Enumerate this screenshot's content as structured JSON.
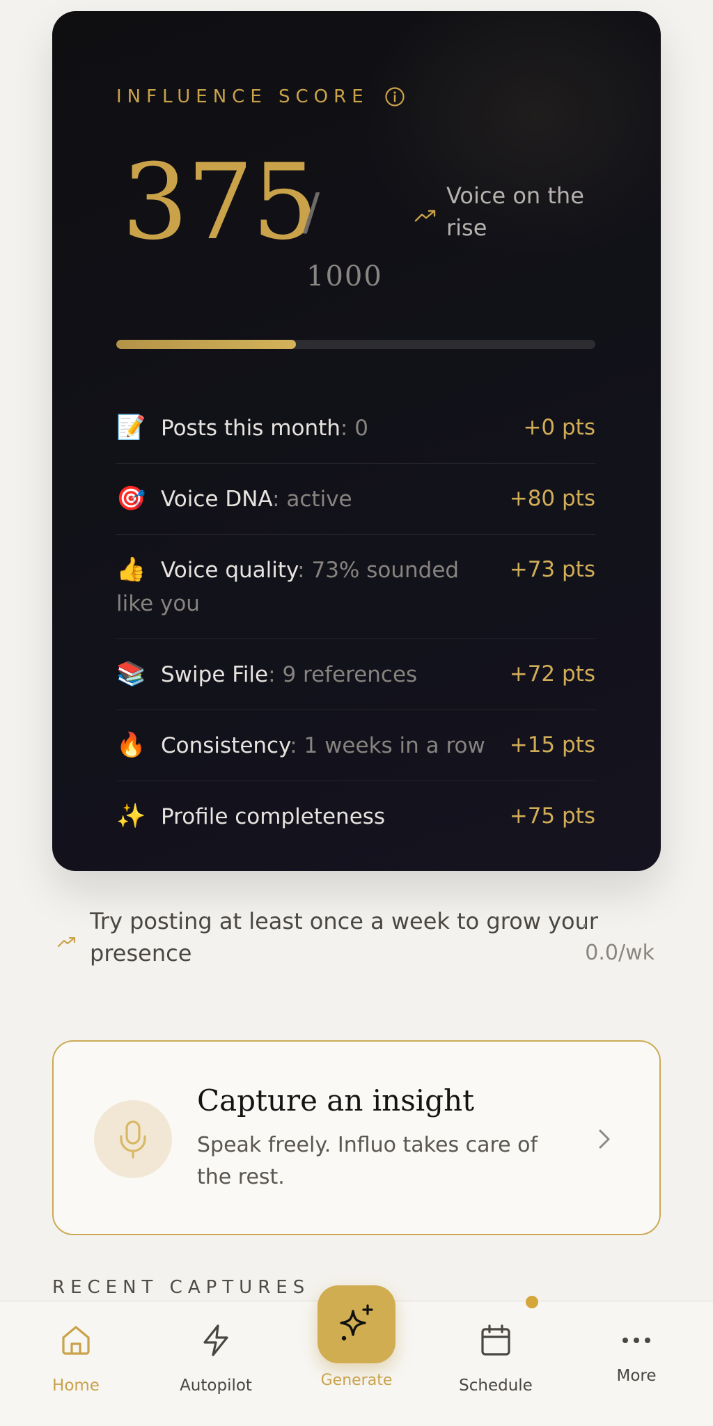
{
  "score_card": {
    "label": "INFLUENCE SCORE",
    "score": "375",
    "slash": "/",
    "max": "1000",
    "trend_text": "Voice on the rise",
    "progress_fraction": 0.375,
    "metrics": [
      {
        "emoji": "📝",
        "name": "Posts this month",
        "sep": ": ",
        "value": "0",
        "points": "+0 pts"
      },
      {
        "emoji": "🎯",
        "name": "Voice DNA",
        "sep": ": ",
        "value": "active",
        "points": "+80 pts"
      },
      {
        "emoji": "👍",
        "name": "Voice quality",
        "sep": ": ",
        "value": "73% sounded like you",
        "points": "+73 pts"
      },
      {
        "emoji": "📚",
        "name": "Swipe File",
        "sep": ": ",
        "value": "9 references",
        "points": "+72 pts"
      },
      {
        "emoji": "🔥",
        "name": "Consistency",
        "sep": ": ",
        "value": "1 weeks in a row",
        "points": "+15 pts"
      },
      {
        "emoji": "✨",
        "name": "Profile completeness",
        "sep": "",
        "value": "",
        "points": "+75 pts"
      }
    ]
  },
  "tip": {
    "text": "Try posting at least once a week to grow your presence",
    "rate": "0.0/wk"
  },
  "capture": {
    "title": "Capture an insight",
    "subtitle": "Speak freely. Influo takes care of the rest."
  },
  "recent_label": "RECENT CAPTURES",
  "nav": {
    "home": "Home",
    "autopilot": "Autopilot",
    "generate": "Generate",
    "schedule": "Schedule",
    "more": "More"
  },
  "colors": {
    "accent": "#c9a24a",
    "card_bg": "#111118",
    "page_bg": "#f4f2ee"
  },
  "icons": {
    "info": "info-icon",
    "trend": "trending-up-icon",
    "mic": "microphone-icon",
    "chevron": "chevron-right-icon",
    "home": "home-icon",
    "autopilot": "lightning-icon",
    "generate": "sparkles-icon",
    "schedule": "calendar-icon",
    "more": "more-dots-icon"
  }
}
